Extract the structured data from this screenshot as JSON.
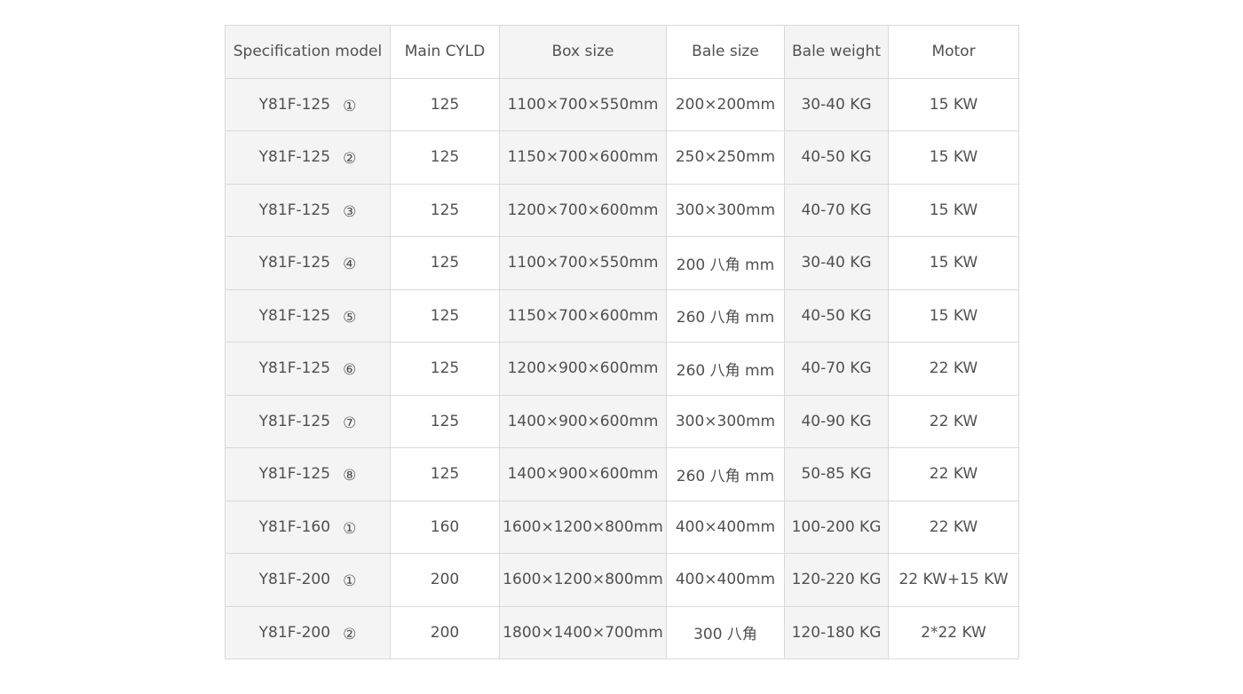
{
  "headers": [
    "Specification model",
    "Main CYLD",
    "Box size",
    "Bale size",
    "Bale weight",
    "Motor"
  ],
  "rows": [
    {
      "model": "Y81F-125",
      "index": "①",
      "cyld": "125",
      "box": "1100×700×550mm",
      "bale_size": "200×200mm",
      "bale_weight": "30-40 KG",
      "motor": "15 KW"
    },
    {
      "model": "Y81F-125",
      "index": "②",
      "cyld": "125",
      "box": "1150×700×600mm",
      "bale_size": "250×250mm",
      "bale_weight": "40-50 KG",
      "motor": "15 KW"
    },
    {
      "model": "Y81F-125",
      "index": "③",
      "cyld": "125",
      "box": "1200×700×600mm",
      "bale_size": "300×300mm",
      "bale_weight": "40-70 KG",
      "motor": "15 KW"
    },
    {
      "model": "Y81F-125",
      "index": "④",
      "cyld": "125",
      "box": "1100×700×550mm",
      "bale_size": "200 八角 mm",
      "bale_weight": "30-40 KG",
      "motor": "15 KW"
    },
    {
      "model": "Y81F-125",
      "index": "⑤",
      "cyld": "125",
      "box": "1150×700×600mm",
      "bale_size": "260 八角 mm",
      "bale_weight": "40-50 KG",
      "motor": "15 KW"
    },
    {
      "model": "Y81F-125",
      "index": "⑥",
      "cyld": "125",
      "box": "1200×900×600mm",
      "bale_size": "260 八角 mm",
      "bale_weight": "40-70 KG",
      "motor": "22 KW"
    },
    {
      "model": "Y81F-125",
      "index": "⑦",
      "cyld": "125",
      "box": "1400×900×600mm",
      "bale_size": "300×300mm",
      "bale_weight": "40-90 KG",
      "motor": "22 KW"
    },
    {
      "model": "Y81F-125",
      "index": "⑧",
      "cyld": "125",
      "box": "1400×900×600mm",
      "bale_size": "260 八角 mm",
      "bale_weight": "50-85 KG",
      "motor": "22 KW"
    },
    {
      "model": "Y81F-160",
      "index": "①",
      "cyld": "160",
      "box": "1600×1200×800mm",
      "bale_size": "400×400mm",
      "bale_weight": "100-200 KG",
      "motor": "22 KW"
    },
    {
      "model": "Y81F-200",
      "index": "①",
      "cyld": "200",
      "box": "1600×1200×800mm",
      "bale_size": "400×400mm",
      "bale_weight": "120-220 KG",
      "motor": "22 KW+15 KW"
    },
    {
      "model": "Y81F-200",
      "index": "②",
      "cyld": "200",
      "box": "1800×1400×700mm",
      "bale_size": "300 八角",
      "bale_weight": "120-180 KG",
      "motor": "2*22 KW"
    }
  ]
}
